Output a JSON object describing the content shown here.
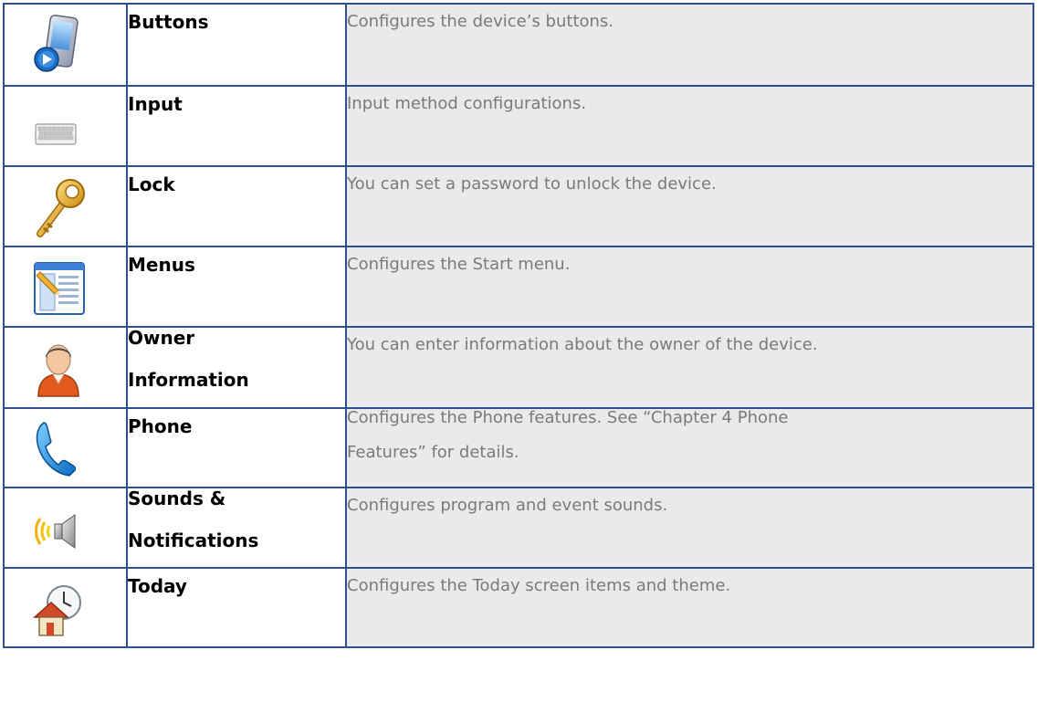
{
  "rows": [
    {
      "name": "Buttons",
      "description": "Configures the device’s buttons.",
      "icon": "device-button-icon"
    },
    {
      "name": "Input",
      "description": "Input method configurations.",
      "icon": "keyboard-icon"
    },
    {
      "name": "Lock",
      "description": "You can set a password to unlock the device.",
      "icon": "key-icon"
    },
    {
      "name": "Menus",
      "description": "Configures the Start menu.",
      "icon": "menu-window-icon"
    },
    {
      "name_line1": "Owner",
      "name_line2": "Information",
      "description": "You can enter information about the owner of the device.",
      "icon": "owner-person-icon"
    },
    {
      "name": "Phone",
      "description_line1": "Configures the Phone features. See “Chapter 4 Phone",
      "description_line2": "Features” for details.",
      "icon": "phone-handset-icon"
    },
    {
      "name_line1": "Sounds &",
      "name_line2": "Notifications",
      "description": "Configures program and event sounds.",
      "icon": "speaker-sound-icon"
    },
    {
      "name": "Today",
      "description": "Configures the Today screen items and theme.",
      "icon": "home-clock-icon"
    }
  ],
  "colors": {
    "border": "#2f4f8f",
    "description_bg": "#eaeaea",
    "description_text": "#7a7a7a"
  }
}
